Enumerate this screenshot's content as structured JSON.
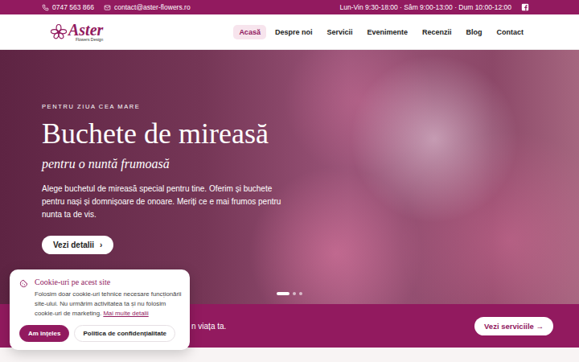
{
  "top_bar": {
    "phone": "0747 563 866",
    "email": "contact@aster-flowers.ro",
    "hours": "Lun-Vin 9:30-18:00 · Sâm 9:00-13:00 · Dum 10:00-12:00"
  },
  "logo": {
    "name": "Aster",
    "tagline": "Flowers Design"
  },
  "nav": [
    {
      "label": "Acasă",
      "selected": true
    },
    {
      "label": "Despre noi",
      "selected": false
    },
    {
      "label": "Servicii",
      "selected": false
    },
    {
      "label": "Evenimente",
      "selected": false
    },
    {
      "label": "Recenzii",
      "selected": false
    },
    {
      "label": "Blog",
      "selected": false
    },
    {
      "label": "Contact",
      "selected": false
    }
  ],
  "hero": {
    "eyebrow": "PENTRU ZIUA CEA MARE",
    "title": "Buchete de mireasă",
    "subtitle": "pentru o nuntă frumoasă",
    "text": "Alege buchetul de mireasă special pentru tine. Oferim și buchete pentru nași și domnișoare de onoare. Meriți ce e mai frumos pentru nunta ta de vis.",
    "button": "Vezi detalii",
    "button_icon": "›"
  },
  "slider": [
    {
      "selected": true
    },
    {
      "selected": false
    },
    {
      "selected": false
    }
  ],
  "strip": {
    "text": "n viața ta.",
    "button": "Vezi serviciile",
    "button_icon": "→"
  },
  "cookie": {
    "title": "Cookie-uri pe acest site",
    "text": "Folosim doar cookie-uri tehnice necesare funcționării site-ului. Nu urmărim activitatea ta și nu folosim cookie-uri de marketing.",
    "link": "Mai multe detalii",
    "buttons": [
      {
        "label": "Am înțeles",
        "kind": "primary"
      },
      {
        "label": "Politica de confidențialitate",
        "kind": "outline"
      }
    ]
  }
}
